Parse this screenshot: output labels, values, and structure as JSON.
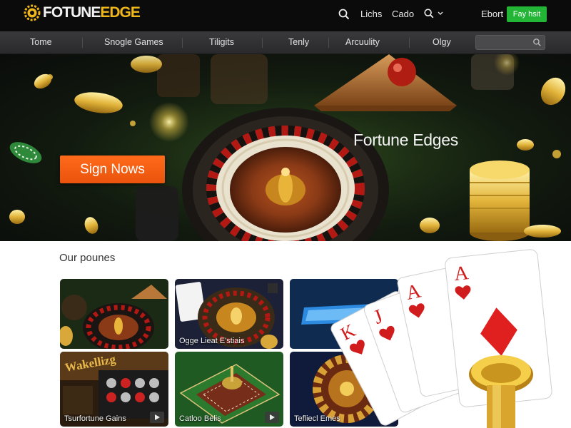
{
  "brand": {
    "name_part1": "FOTUNE",
    "name_part2": "EDGE",
    "accent": "#f0b71a"
  },
  "header": {
    "links": [
      "Lichs",
      "Cado"
    ],
    "dropdown_icon": "search-icon",
    "account_link": "Ebort",
    "cta_label": "Fay hsit",
    "cta_color": "#22b536"
  },
  "nav": {
    "items": [
      "Tome",
      "Snogle Games",
      "Tiligits",
      "Tenly",
      "Arcuulity",
      "Olgy"
    ],
    "search_placeholder": ""
  },
  "hero": {
    "title": "Fortune Edges",
    "button_label": "Sign Nows",
    "button_color": "#f0621a"
  },
  "games": {
    "title": "Our pounes",
    "cards": [
      {
        "caption": ""
      },
      {
        "caption": "Ogge Lieat E'stiais"
      },
      {
        "caption": ""
      },
      {
        "caption": "Tsurfortune Gains"
      },
      {
        "caption": "Catloo Belis"
      },
      {
        "caption": "Tefliecl Emes"
      }
    ]
  }
}
